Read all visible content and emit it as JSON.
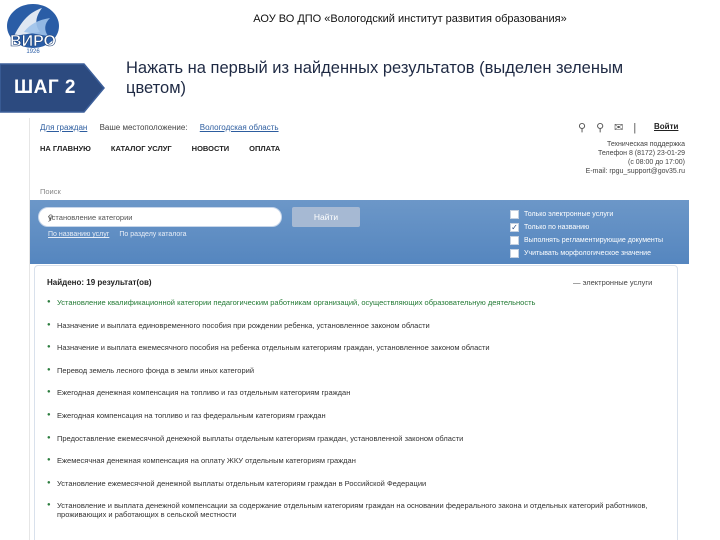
{
  "header": {
    "org_title": "АОУ ВО ДПО «Вологодский институт развития образования»",
    "logo_text": "ВИРО",
    "logo_year": "1926"
  },
  "step": {
    "label": "ШАГ 2",
    "instruction": "Нажать на первый из найденных результатов (выделен зеленым цветом)",
    "badge_color": "#2c4a7f"
  },
  "portal": {
    "topline": {
      "for_citizens": "Для граждан",
      "location_prefix": "Ваше местоположение:",
      "location": "Вологодская область"
    },
    "login_label": "Войти",
    "nav": [
      "На главную",
      "Каталог услуг",
      "Новости",
      "Оплата"
    ],
    "support": [
      "Техническая поддержка",
      "Телефон 8 (8172) 23-01-29",
      "(с 08:00 до 17:00)",
      "E-mail: rpgu_support@gov35.ru"
    ],
    "breadcrumb": "Поиск",
    "search": {
      "value": "установление категории",
      "button": "Найти",
      "tabs": [
        "По названию услуг",
        "По разделу каталога"
      ]
    },
    "filters": [
      {
        "label": "Только электронные услуги",
        "checked": false
      },
      {
        "label": "Только по названию",
        "checked": true
      },
      {
        "label": "Выполнять регламентирующие документы",
        "checked": false
      },
      {
        "label": "Учитывать морфологическое значение",
        "checked": false
      }
    ],
    "results_count": "Найдено: 19 результат(ов)",
    "legend": "— электронные услуги",
    "results": [
      "Установление квалификационной категории педагогическим работникам организаций, осуществляющих образовательную деятельность",
      "Назначение и выплата единовременного пособия при рождении ребенка, установленное законом области",
      "Назначение и выплата ежемесячного пособия на ребенка отдельным категориям граждан, установленное законом области",
      "Перевод земель лесного фонда в земли иных категорий",
      "Ежегодная денежная компенсация на топливо и газ отдельным категориям граждан",
      "Ежегодная компенсация на топливо и газ федеральным категориям граждан",
      "Предоставление ежемесячной денежной выплаты отдельным категориям граждан, установленной законом области",
      "Ежемесячная денежная компенсация на оплату ЖКУ отдельным категориям граждан",
      "Установление ежемесячной денежной выплаты отдельным категориям граждан в Российской Федерации",
      "Установление и выплата денежной компенсации за содержание отдельным категориям граждан на основании федерального закона и отдельных категорий работников, проживающих и работающих в сельской местности"
    ],
    "highlight_color": "#227a34"
  }
}
